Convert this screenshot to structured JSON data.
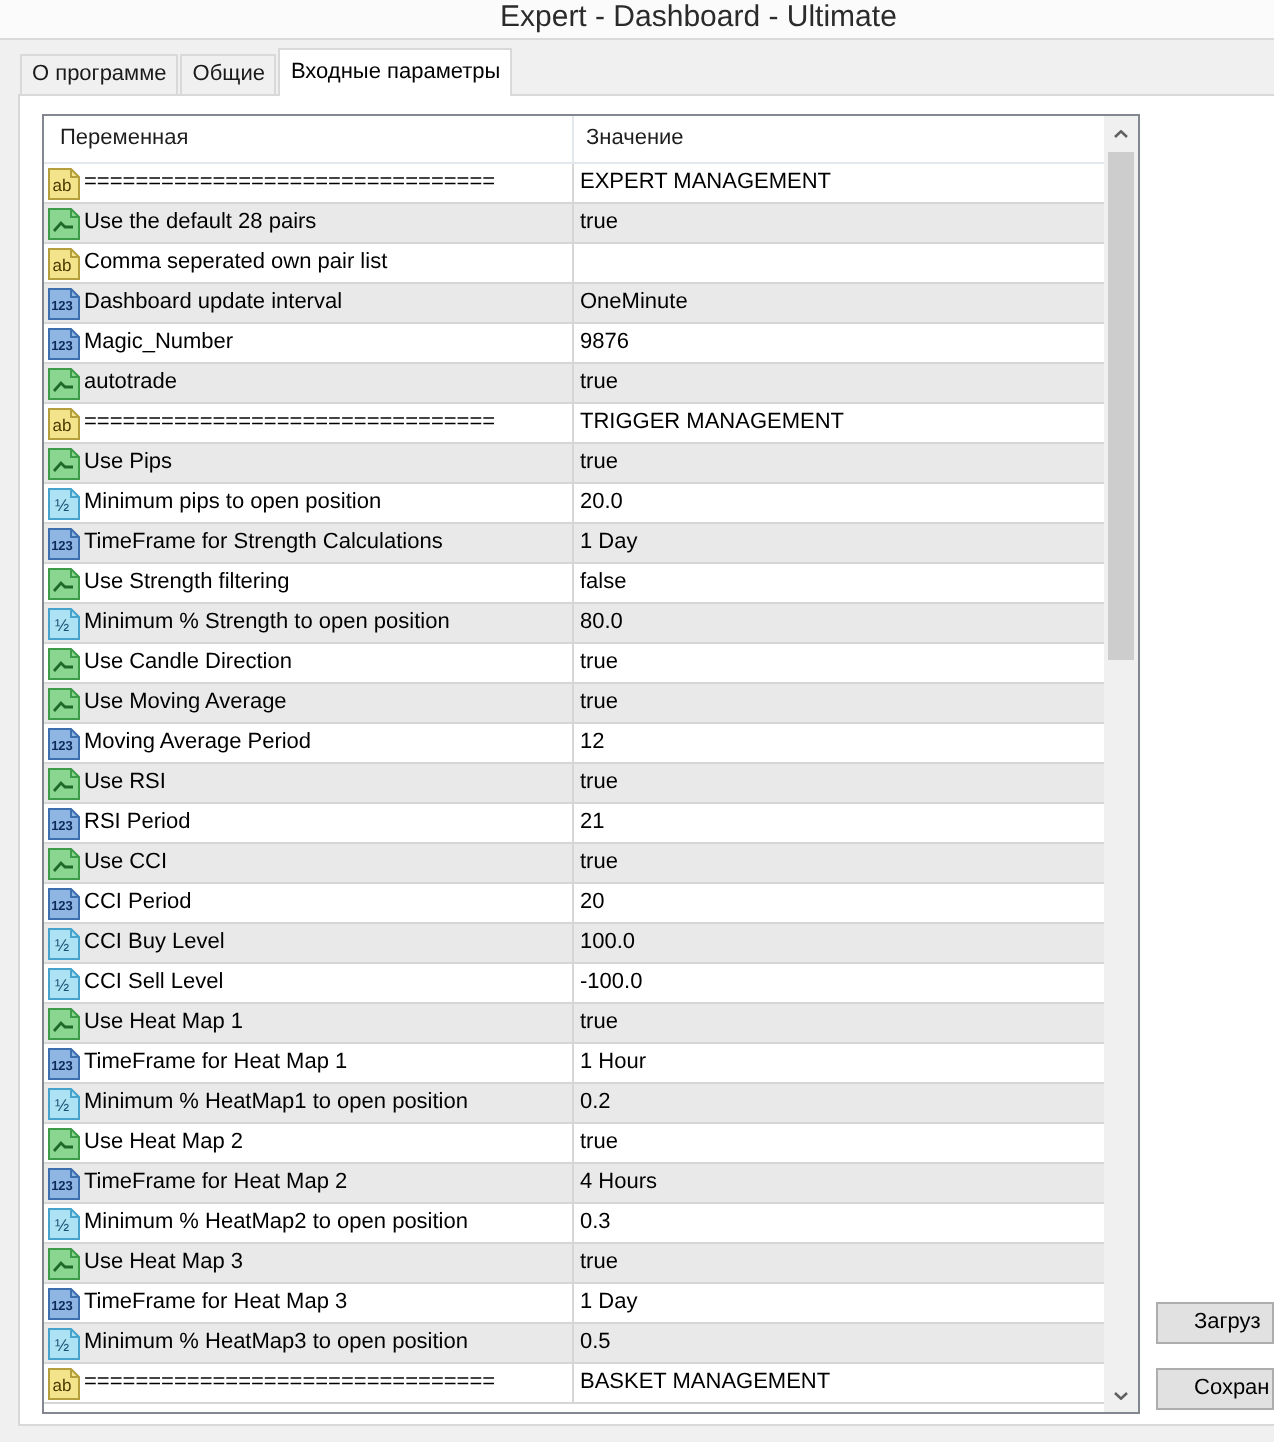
{
  "window": {
    "title": "Expert - Dashboard - Ultimate"
  },
  "tabs": [
    {
      "label": "О программе",
      "selected": false
    },
    {
      "label": "Общие",
      "selected": false
    },
    {
      "label": "Входные параметры",
      "selected": true
    }
  ],
  "table": {
    "columns": [
      "Переменная",
      "Значение"
    ],
    "rows": [
      {
        "kind": "string",
        "badge": "ab",
        "name": "================================",
        "value": "EXPERT MANAGEMENT"
      },
      {
        "kind": "bool",
        "name": "Use the default 28 pairs",
        "value": "true"
      },
      {
        "kind": "string",
        "badge": "ab",
        "name": "Comma seperated own pair list"
      },
      {
        "kind": "int",
        "badge": "123",
        "name": "Dashboard update interval",
        "value": "OneMinute"
      },
      {
        "kind": "int",
        "badge": "123",
        "name": "Magic_Number",
        "value": "9876"
      },
      {
        "kind": "bool",
        "name": "autotrade",
        "value": "true"
      },
      {
        "kind": "string",
        "badge": "ab",
        "name": "================================",
        "value": "TRIGGER MANAGEMENT"
      },
      {
        "kind": "bool",
        "name": "Use Pips",
        "value": "true"
      },
      {
        "kind": "double",
        "badge": "½",
        "name": "Minimum pips to open position",
        "value": "20.0"
      },
      {
        "kind": "int",
        "badge": "123",
        "name": "TimeFrame for Strength Calculations",
        "value": "1 Day"
      },
      {
        "kind": "bool",
        "name": "Use Strength filtering",
        "value": "false"
      },
      {
        "kind": "double",
        "badge": "½",
        "name": "Minimum % Strength to open position",
        "value": "80.0"
      },
      {
        "kind": "bool",
        "name": "Use Candle Direction",
        "value": "true"
      },
      {
        "kind": "bool",
        "name": "Use Moving Average",
        "value": "true"
      },
      {
        "kind": "int",
        "badge": "123",
        "name": "Moving Average Period",
        "value": "12"
      },
      {
        "kind": "bool",
        "name": "Use RSI",
        "value": "true"
      },
      {
        "kind": "int",
        "badge": "123",
        "name": "RSI Period",
        "value": "21"
      },
      {
        "kind": "bool",
        "name": "Use CCI",
        "value": "true"
      },
      {
        "kind": "int",
        "badge": "123",
        "name": "CCI Period",
        "value": "20"
      },
      {
        "kind": "double",
        "badge": "½",
        "name": "CCI Buy Level",
        "value": "100.0"
      },
      {
        "kind": "double",
        "badge": "½",
        "name": "CCI Sell Level",
        "value": "-100.0"
      },
      {
        "kind": "bool",
        "name": "Use Heat Map 1",
        "value": "true"
      },
      {
        "kind": "int",
        "badge": "123",
        "name": "TimeFrame for Heat Map 1",
        "value": "1 Hour"
      },
      {
        "kind": "double",
        "badge": "½",
        "name": "Minimum % HeatMap1 to open position",
        "value": "0.2"
      },
      {
        "kind": "bool",
        "name": "Use Heat Map 2",
        "value": "true"
      },
      {
        "kind": "int",
        "badge": "123",
        "name": "TimeFrame for Heat Map 2",
        "value": "4 Hours"
      },
      {
        "kind": "double",
        "badge": "½",
        "name": "Minimum % HeatMap2 to open position",
        "value": "0.3"
      },
      {
        "kind": "bool",
        "name": "Use Heat Map 3",
        "value": "true"
      },
      {
        "kind": "int",
        "badge": "123",
        "name": "TimeFrame for Heat Map 3",
        "value": "1 Day"
      },
      {
        "kind": "double",
        "badge": "½",
        "name": "Minimum % HeatMap3 to open position",
        "value": "0.5"
      },
      {
        "kind": "string",
        "badge": "ab",
        "name": "================================",
        "value": "BASKET MANAGEMENT"
      }
    ]
  },
  "buttons": [
    "Загруз",
    "Сохран"
  ]
}
